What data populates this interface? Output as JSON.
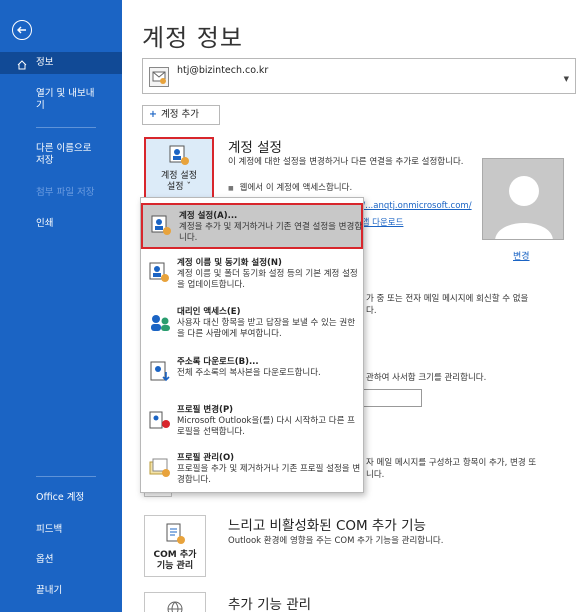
{
  "sidebar": {
    "items": [
      {
        "label": "정보"
      },
      {
        "label": "열기 및 내보내기"
      },
      {
        "label": "다른 이름으로 저장"
      },
      {
        "label": "첨부 파일 저장"
      },
      {
        "label": "인쇄"
      },
      {
        "label": "Office 계정"
      },
      {
        "label": "피드백"
      },
      {
        "label": "옵션"
      },
      {
        "label": "끝내기"
      }
    ]
  },
  "main": {
    "title": "계정 정보",
    "account_email": "htj@bizintech.co.kr",
    "add_account": "계정 추가",
    "settings_tile": "계정 설정",
    "settings_tile_sub": "설정 ˇ",
    "settings_head": "계정 설정",
    "settings_desc": "이 계정에 대한 설정을 변경하거나 다른 연결을 추가로 설정합니다.",
    "web_access": "웹에서 이 계정에 액세스합니다.",
    "web_link": "m/...anqtj.onmicrosoft.com/",
    "app_link": "k 앱 다운로드",
    "avatar_change": "변경",
    "oof_desc": "가 중 또는 전자 메일 메시지에 회신할 수 없을",
    "oof_desc2": "다.",
    "mailbox_desc": "관하여 사서함 크기를 관리합니다.",
    "rules_desc": "자 메일 메시지를 구성하고 항목이 추가, 변경 또",
    "rules_desc2": "니다.",
    "com_head": "느리고 비활성화된 COM 추가 기능",
    "com_desc": "Outlook 환경에 영향을 주는 COM 추가 기능을 관리합니다.",
    "com_tile_1": "COM 추가",
    "com_tile_2": "기능 관리",
    "addin_head": "추가 기능 관리"
  },
  "dropdown": {
    "items": [
      {
        "title": "계정 설정(A)...",
        "desc": "계정을 추가 및 제거하거나 기존 연결 설정을 변경합니다."
      },
      {
        "title": "계정 이름 및 동기화 설정(N)",
        "desc": "계정 이름 및 폴더 동기화 설정 등의 기본 계정 설정을 업데이트합니다."
      },
      {
        "title": "대리인 액세스(E)",
        "desc": "사용자 대신 항목을 받고 답장을 보낼 수 있는 권한을 다른 사람에게 부여합니다."
      },
      {
        "title": "주소록 다운로드(B)...",
        "desc": "전체 주소록의 복사본을 다운로드합니다."
      },
      {
        "title": "프로필 변경(P)",
        "desc": "Microsoft Outlook을(를) 다시 시작하고 다른 프로필을 선택합니다."
      },
      {
        "title": "프로필 관리(O)",
        "desc": "프로필을 추가 및 제거하거나 기존 프로필 설정을 변경합니다."
      }
    ]
  },
  "colors": {
    "sidebar": "#1b64c4",
    "highlight_border": "#d8262c",
    "link": "#1b64c4"
  }
}
